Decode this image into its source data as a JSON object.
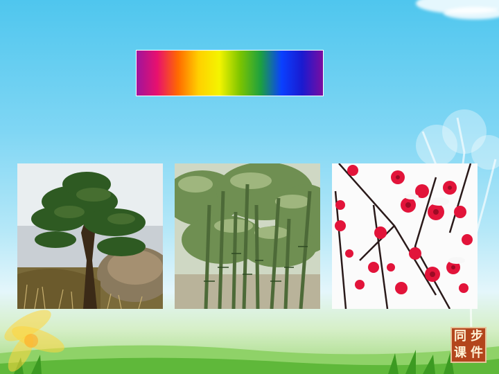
{
  "colors": {
    "spectrum": [
      "#a0149c",
      "#e8106e",
      "#ff6a00",
      "#ffd000",
      "#f4f400",
      "#7cc400",
      "#1ca040",
      "#0a40ff",
      "#1a1ad0",
      "#7a0ca0"
    ]
  },
  "photos": [
    {
      "subject": "pine-tree"
    },
    {
      "subject": "bamboo"
    },
    {
      "subject": "plum-blossom"
    }
  ],
  "logo": {
    "chars": [
      "同",
      "步",
      "课",
      "件"
    ]
  }
}
